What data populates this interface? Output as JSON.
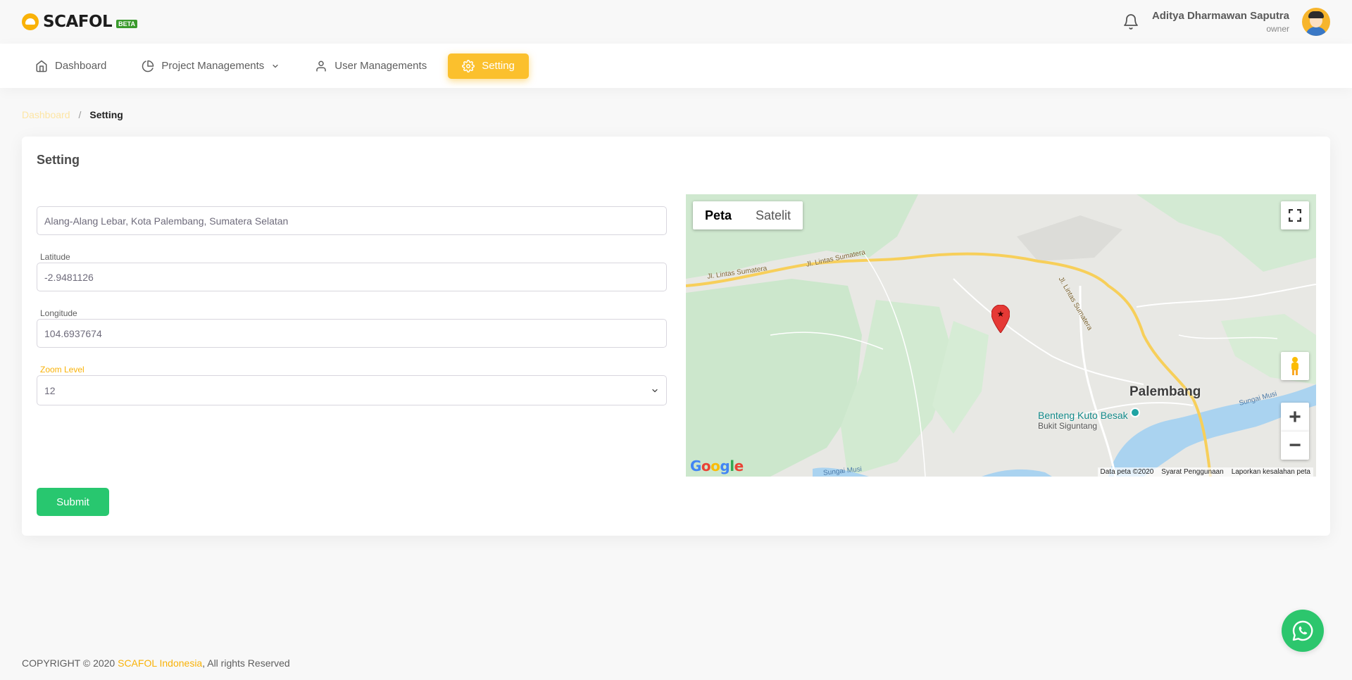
{
  "brand": {
    "name": "SCAFOL",
    "badge": "BETA"
  },
  "header": {
    "user_name": "Aditya Dharmawan Saputra",
    "user_role": "owner"
  },
  "nav": {
    "items": [
      {
        "label": "Dashboard",
        "icon": "home-icon"
      },
      {
        "label": "Project Managements",
        "icon": "pie-chart-icon"
      },
      {
        "label": "User Managements",
        "icon": "user-icon"
      },
      {
        "label": "Setting",
        "icon": "settings-icon",
        "active": true
      }
    ]
  },
  "breadcrumb": {
    "parent": "Dashboard",
    "separator": "/",
    "current": "Setting"
  },
  "card": {
    "title": "Setting"
  },
  "form": {
    "address_value": "Alang-Alang Lebar, Kota Palembang, Sumatera Selatan",
    "latitude_label": "Latitude",
    "latitude_value": "-2.9481126",
    "longitude_label": "Longitude",
    "longitude_value": "104.6937674",
    "zoom_label": "Zoom Level",
    "zoom_value": "12",
    "submit_label": "Submit"
  },
  "map": {
    "type_map": "Peta",
    "type_satellite": "Satelit",
    "city_label": "Palembang",
    "poi_label": "Benteng Kuto Besak",
    "area_label": "Bukit Siguntang",
    "road_label_1": "Jl. Lintas Sumatera",
    "road_label_2": "Jl. Lintas Sumatera",
    "road_label_3": "Jl. Lintas Sumatera",
    "river_label_1": "Sungai Musi",
    "river_label_2": "Sungai Musi",
    "provider": "Google",
    "attribution_data": "Data peta ©2020",
    "attribution_terms": "Syarat Penggunaan",
    "attribution_report": "Laporkan kesalahan peta",
    "zoom_in": "+",
    "zoom_out": "−"
  },
  "footer": {
    "prefix": "COPYRIGHT © 2020 ",
    "company": "SCAFOL Indonesia",
    "suffix": ", All rights Reserved"
  },
  "colors": {
    "accent": "#fbc02d",
    "success": "#28c76f",
    "whatsapp": "#2cc66d"
  }
}
